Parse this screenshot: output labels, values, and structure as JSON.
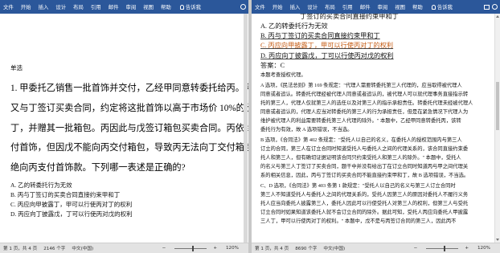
{
  "ribbon": {
    "tabs": [
      "文件",
      "开始",
      "插入",
      "设计",
      "布局",
      "引用",
      "邮件",
      "审阅",
      "视图",
      "帮助"
    ],
    "tell_me": "告诉我"
  },
  "left": {
    "single_choice_label": "单选",
    "paragraph_lines": [
      "1. 甲委托乙销售一批首饰并交付，乙经甲同意转委托给丙。丙",
      "又与丁签订买卖合同，约定将这批首饰以高于市场价 10%的价",
      "丁，并赠其一批箱包。丙因此与戊签订箱包买卖合同。丙依约",
      "付首饰，但因戊不能向丙交付箱包，导致丙无法向丁交付箱包",
      "绝向丙支付首饰款。下列哪一表述是正确的?"
    ],
    "options": [
      "A. 乙的转委托行为无效",
      "B. 丙与丁签订的买卖合同直接约束甲和丁",
      "C. 丙应向甲披露丁，甲可以行使丙对丁的权利",
      "D. 丙应向丁披露戊，丁可以行使丙对戊的权利"
    ],
    "status": {
      "page": "第 1 页，共 4 页",
      "words": "2146 个字",
      "language": "中文(中国)",
      "zoom": "120%"
    }
  },
  "right": {
    "top_partial": "丁签订的买卖合同直接约束甲和丁",
    "options": [
      "A. 乙的转委托行为无效",
      "B. 丙与丁签订的买卖合同直接约束甲和丁",
      "C. 丙应向甲披露丁，甲可以行使丙对丁的权利",
      "D. 丙应向丁披露戊，丁可以行使丙对戊的权利"
    ],
    "answer": "答案：C",
    "review_title": "本题考查授权代理。",
    "body_lines": [
      "A 选项，《民法总则》第 169 条规定：\"代理人需要转委托第三人代理的，应当取得被代理人",
      "同意或者追认。转委托代理经被代理人同意或者追认的，被代理人可以就代理事务直接指示转",
      "托的第三人，代理人仅就第三人的选任以及对第三人的指示承担责任。转委托代理未经被代理人",
      "同意或者追认的，代理人应当对转委托的第三人的行为承担责任，但是在紧急情况下代理人为",
      "维护被代理人的利益需要转委托第三人代理的除外。\" 本题中，乙经甲同意转委托丙，该转",
      "委托行为有效，故 A 选项错误，不当选。",
      "B 选项，《合同法》第 402 条规定：\"受托人以自己的名义，在委托人的授权范围内与第三人",
      "订立的合同，第三人在订立合同时知道受托人与委托人之间的代理关系的，该合同直接约束委",
      "托人和第三人，但有确切证据证明该合同只约束受托人和第三人的除外。\" 本题中，受托人",
      "的名义与第三人丁签订了买卖合同，题干中并没有给出丁在订立合同时知道丙与甲之间代理关",
      "系的相关信息，因此，丙与丁签订的买卖合同不能直接约束甲和丁，故 B 选项错误，不当选。",
      "C、D 选项，《合同法》第 403 条第 1 款规定：\"受托人以自己的名义与第三人订立合同时",
      "第三人不知道受托人与委托人之间的代理关系的，受托人因第三人的原因对委托人不履行义务",
      "托人应当向委托人披露第三人，委托人因此可以行使受托人对第三人的权利，但第三人与受托",
      "订立合同时如果知道该委托人就不会订立合同的除外。据此可知，受托人丙应向委托人甲披露",
      "三人丁，甲可以行使丙对丁的权利。\" 本题中，戊不是与丙签订合同的第三人，因此丙不"
    ],
    "status": {
      "page": "第 1 页，共 4 页",
      "words": "8690 个字",
      "language": "中文(中国)",
      "zoom": "120%"
    }
  },
  "colors": {
    "ribbon": "#2b579a",
    "tracked_change": "#c55a11"
  }
}
